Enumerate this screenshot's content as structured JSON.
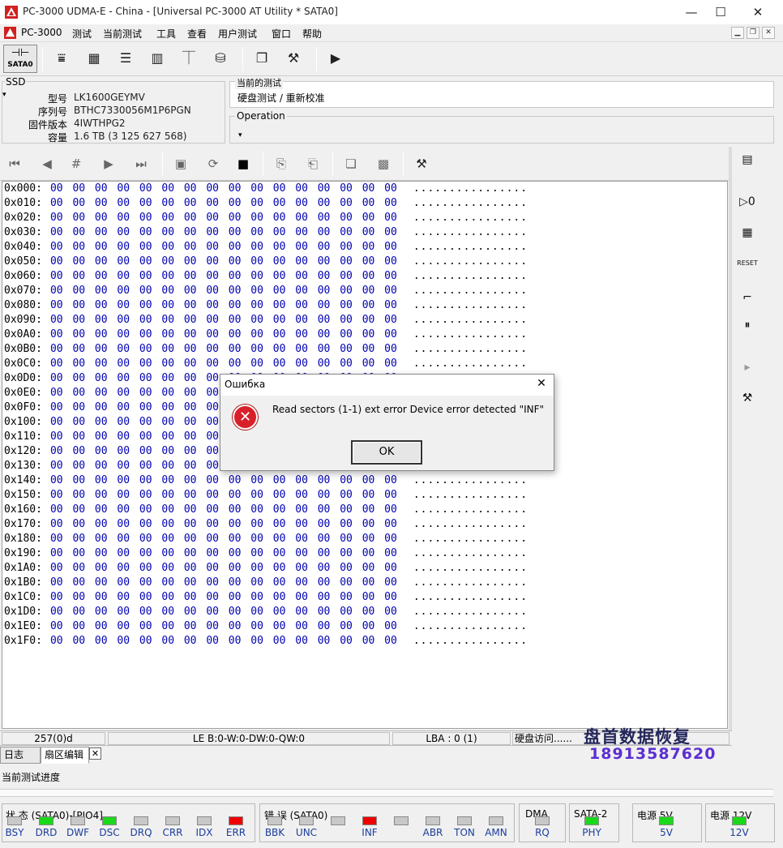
{
  "window": {
    "title": "PC-3000 UDMA-E - China - [Universal PC-3000 AT Utility * SATA0]",
    "minimize": "—",
    "maximize": "☐",
    "close": "✕"
  },
  "menu": {
    "items": [
      "PC-3000",
      "测试",
      "当前测试",
      "工具",
      "查看",
      "用户测试",
      "窗口",
      "帮助"
    ]
  },
  "toolbar1": {
    "sata_label": "SATA0"
  },
  "ssd": {
    "legend": "SSD",
    "fields": [
      {
        "key": "型号",
        "value": "LK1600GEYMV"
      },
      {
        "key": "序列号",
        "value": "BTHC7330056M1P6PGN"
      },
      {
        "key": "固件版本",
        "value": "4IWTHPG2"
      },
      {
        "key": "容量",
        "value": "1.6 TB (3 125 627 568)"
      }
    ]
  },
  "current_test": {
    "legend": "当前的测试",
    "value": "硬盘测试 / 重新校准"
  },
  "operation": {
    "legend": "Operation"
  },
  "hex": {
    "addresses": [
      "0x000:",
      "0x010:",
      "0x020:",
      "0x030:",
      "0x040:",
      "0x050:",
      "0x060:",
      "0x070:",
      "0x080:",
      "0x090:",
      "0x0A0:",
      "0x0B0:",
      "0x0C0:",
      "0x0D0:",
      "0x0E0:",
      "0x0F0:",
      "0x100:",
      "0x110:",
      "0x120:",
      "0x130:",
      "0x140:",
      "0x150:",
      "0x160:",
      "0x170:",
      "0x180:",
      "0x190:",
      "0x1A0:",
      "0x1B0:",
      "0x1C0:",
      "0x1D0:",
      "0x1E0:",
      "0x1F0:"
    ],
    "bytes": "00 00 00 00 00 00 00 00 00 00 00 00 00 00 00 00",
    "ascii": "................"
  },
  "status": {
    "sector": "257(0)d",
    "regs": "LE B:0-W:0-DW:0-QW:0",
    "lba": "LBA : 0 (1)",
    "access": "硬盘访问......"
  },
  "watermark": {
    "name": "盘首数据恢复",
    "phone": "18913587620"
  },
  "tabs": [
    {
      "label": "日志"
    },
    {
      "label": "扇区编辑"
    }
  ],
  "progress_label": "当前测试进度",
  "indicators": {
    "state_title": "状 态 (SATA0)-[PIO4]",
    "state": [
      {
        "label": "BSY",
        "color": "gray"
      },
      {
        "label": "DRD",
        "color": "green"
      },
      {
        "label": "DWF",
        "color": "gray"
      },
      {
        "label": "DSC",
        "color": "green"
      },
      {
        "label": "DRQ",
        "color": "gray"
      },
      {
        "label": "CRR",
        "color": "gray"
      },
      {
        "label": "IDX",
        "color": "gray"
      },
      {
        "label": "ERR",
        "color": "red"
      }
    ],
    "error_title": "错 误 (SATA0)",
    "error": [
      {
        "label": "BBK",
        "color": "gray"
      },
      {
        "label": "UNC",
        "color": "gray"
      },
      {
        "label": "",
        "color": "gray"
      },
      {
        "label": "INF",
        "color": "red"
      },
      {
        "label": "",
        "color": "gray"
      },
      {
        "label": "ABR",
        "color": "gray"
      },
      {
        "label": "TON",
        "color": "gray"
      },
      {
        "label": "AMN",
        "color": "gray"
      }
    ],
    "dma_title": "DMA",
    "dma": {
      "label": "RQ",
      "color": "gray"
    },
    "sata2_title": "SATA-2",
    "sata2": {
      "label": "PHY",
      "color": "green"
    },
    "p5_title": "电源 5V",
    "p5": {
      "label": "5V",
      "color": "green"
    },
    "p12_title": "电源 12V",
    "p12": {
      "label": "12V",
      "color": "green"
    }
  },
  "dialog": {
    "title": "Ошибка",
    "message": "Read sectors (1-1) ext error Device error detected \"INF\"",
    "ok": "OK",
    "close": "✕"
  },
  "colors": {
    "hex_bytes": "#0000b0",
    "led_green": "#1bd81b",
    "led_red": "#f00000",
    "watermark": "#24275a",
    "phone": "#5b2fd1"
  }
}
